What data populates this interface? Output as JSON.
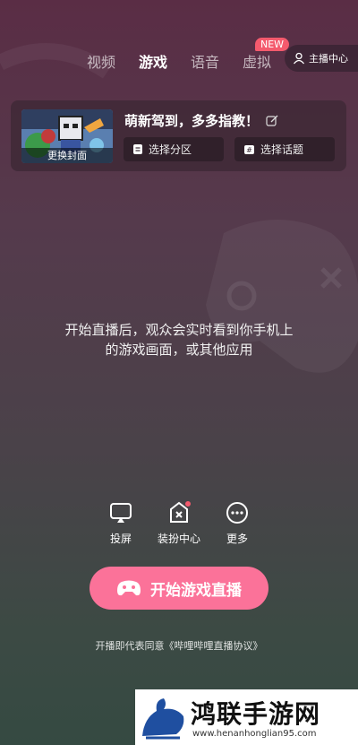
{
  "tabs": [
    {
      "label": "视频",
      "active": false
    },
    {
      "label": "游戏",
      "active": true
    },
    {
      "label": "语音",
      "active": false
    },
    {
      "label": "虚拟",
      "active": false
    }
  ],
  "new_badge": "NEW",
  "anchor_center": {
    "label": "主播中心",
    "icon": "user-icon"
  },
  "card": {
    "cover_label": "更换封面",
    "room_title": "萌新驾到，多多指教！",
    "select_area": {
      "label": "选择分区",
      "icon": "document-icon"
    },
    "select_topic": {
      "label": "选择话题",
      "icon": "topic-icon"
    }
  },
  "center_message": {
    "line1": "开始直播后，观众会实时看到你手机上",
    "line2": "的游戏画面，或其他应用"
  },
  "actions": [
    {
      "label": "投屏",
      "icon": "cast-icon"
    },
    {
      "label": "装扮中心",
      "icon": "decorate-icon"
    },
    {
      "label": "更多",
      "icon": "more-icon"
    }
  ],
  "start_button": {
    "label": "开始游戏直播",
    "icon": "gamepad-icon"
  },
  "agreement": "开播即代表同意《哔哩哔哩直播协议》",
  "watermark": {
    "title": "鸿联手游网",
    "url": "www.henanhonglian95.com"
  },
  "colors": {
    "accent": "#fb7299",
    "badge": "#f45a6d"
  }
}
